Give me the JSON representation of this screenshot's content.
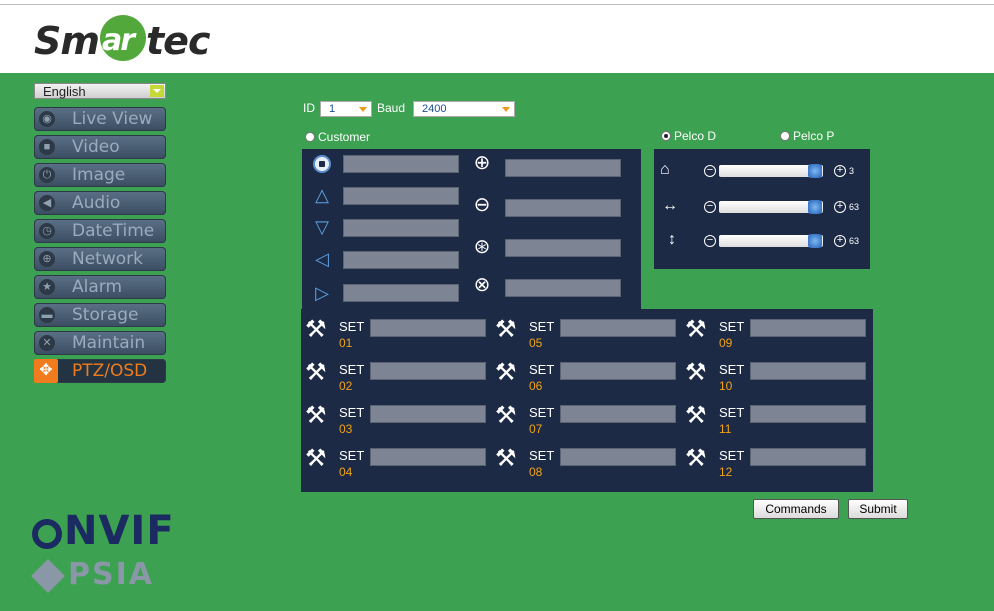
{
  "header": {
    "logo_text_left": "Sm",
    "logo_text_circle": "ar",
    "logo_text_right": "tec"
  },
  "language": {
    "selected": "English"
  },
  "nav": [
    {
      "label": "Live View",
      "icon": "eye-icon"
    },
    {
      "label": "Video",
      "icon": "camera-icon"
    },
    {
      "label": "Image",
      "icon": "power-icon"
    },
    {
      "label": "Audio",
      "icon": "speaker-icon"
    },
    {
      "label": "DateTime",
      "icon": "clock-icon"
    },
    {
      "label": "Network",
      "icon": "globe-icon"
    },
    {
      "label": "Alarm",
      "icon": "star-icon"
    },
    {
      "label": "Storage",
      "icon": "storage-icon"
    },
    {
      "label": "Maintain",
      "icon": "wrench-icon"
    },
    {
      "label": "PTZ/OSD",
      "icon": "ptz-icon",
      "active": true
    }
  ],
  "ptz": {
    "id_label": "ID",
    "id_value": "1",
    "baud_label": "Baud",
    "baud_value": "2400",
    "customer_label": "Customer",
    "pelco_d_label": "Pelco D",
    "pelco_p_label": "Pelco P",
    "protocol_selected": "Pelco D",
    "sliders": [
      {
        "name": "home",
        "value": "3",
        "level": 0.99
      },
      {
        "name": "pan-speed",
        "value": "63",
        "level": 0.99
      },
      {
        "name": "tilt-speed",
        "value": "63",
        "level": 0.99
      }
    ],
    "preset_label": "SET",
    "presets": [
      "01",
      "02",
      "03",
      "04",
      "05",
      "06",
      "07",
      "08",
      "09",
      "10",
      "11",
      "12"
    ]
  },
  "buttons": {
    "commands": "Commands",
    "submit": "Submit"
  },
  "logos": {
    "onvif_text": "NVIF",
    "psia_text": "PSIA"
  },
  "colors": {
    "background": "#3ca150",
    "panel": "#1d2a45",
    "accent": "#f07c1d",
    "preset_number": "#f2a313"
  }
}
